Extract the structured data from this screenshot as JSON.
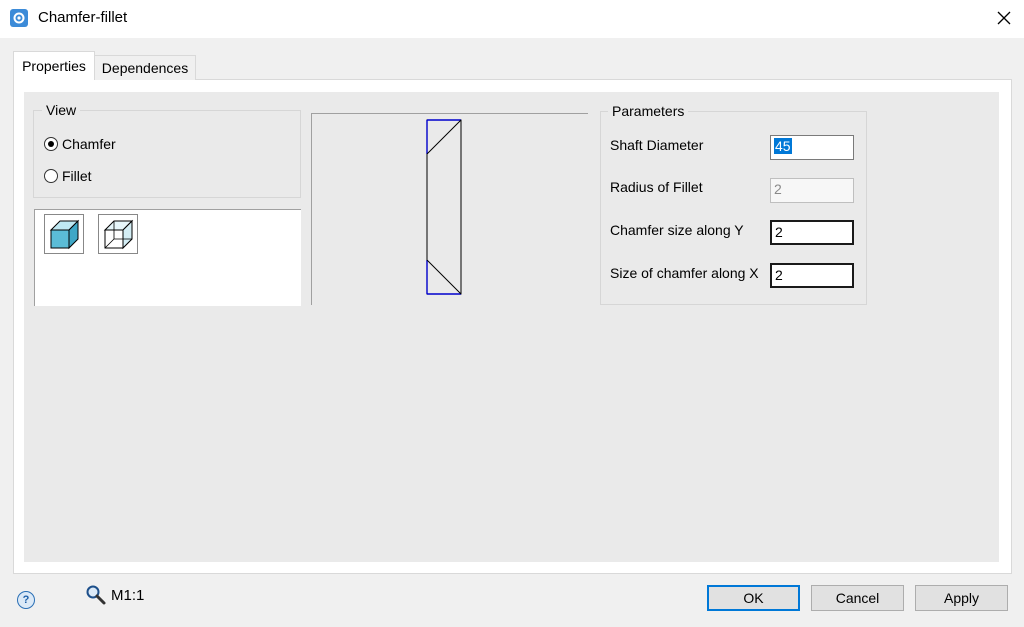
{
  "window": {
    "title": "Chamfer-fillet",
    "close_icon": "close-icon",
    "app_icon": "gear-icon"
  },
  "tabs": [
    {
      "label": "Properties",
      "active": true
    },
    {
      "label": "Dependences",
      "active": false
    }
  ],
  "view": {
    "legend": "View",
    "options": [
      {
        "label": "Chamfer",
        "selected": true
      },
      {
        "label": "Fillet",
        "selected": false
      }
    ],
    "icons": [
      "shaded-cube-icon",
      "wireframe-cube-icon"
    ]
  },
  "parameters": {
    "legend": "Parameters",
    "shaft_diameter": {
      "label": "Shaft Diameter",
      "value": "45"
    },
    "radius_of_fillet": {
      "label": "Radius of Fillet",
      "value": "2",
      "disabled": true
    },
    "chamfer_y": {
      "label": "Chamfer size along Y",
      "value": "2"
    },
    "chamfer_x": {
      "label": "Size of chamfer along X",
      "value": "2"
    }
  },
  "footer": {
    "help_icon": "help-icon",
    "zoom_icon": "magnifier-icon",
    "zoom_label": "M1:1",
    "ok": "OK",
    "cancel": "Cancel",
    "apply": "Apply"
  },
  "colors": {
    "accent": "#0078d7",
    "preview_outline": "#0000cc",
    "cube_face": "#5bbcd6"
  }
}
